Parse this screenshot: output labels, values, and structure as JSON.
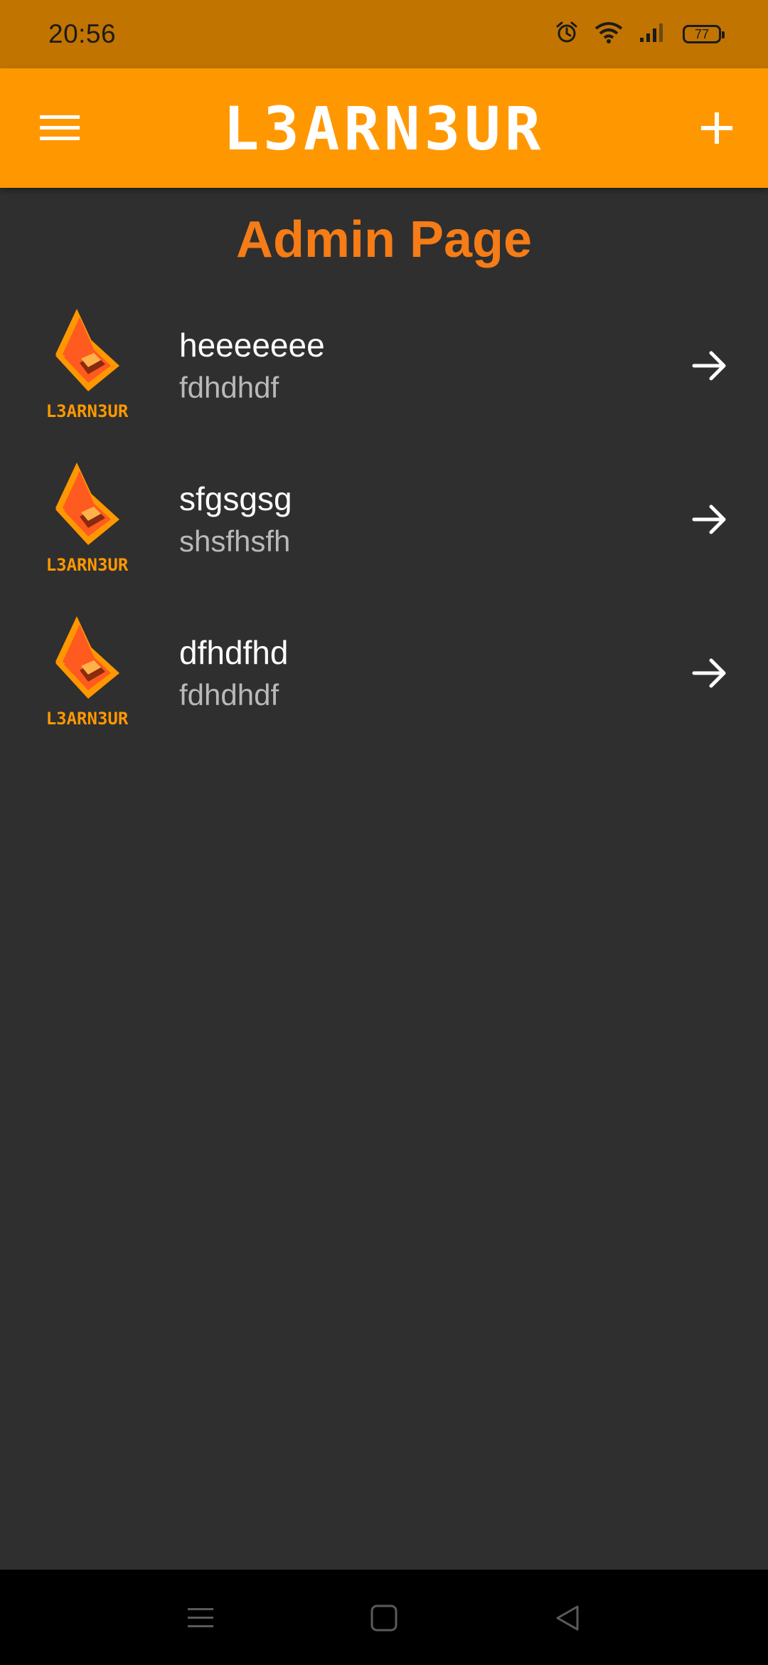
{
  "status_bar": {
    "time": "20:56",
    "battery": "77",
    "icons": [
      "alarm-icon",
      "wifi-icon",
      "signal-icon",
      "battery-icon"
    ]
  },
  "app_bar": {
    "brand": "L3ARN3UR",
    "menu_icon": "hamburger-menu-icon",
    "add_icon": "plus-icon",
    "color": "#ff9800"
  },
  "page": {
    "title": "Admin Page",
    "title_color": "#f57c16",
    "background": "#2f2f2f"
  },
  "list": {
    "items": [
      {
        "title": "heeeeeee",
        "subtitle": "fdhdhdf",
        "logo_text": "L3ARN3UR",
        "icon": "arrow-right-icon"
      },
      {
        "title": "sfgsgsg",
        "subtitle": "shsfhsfh",
        "logo_text": "L3ARN3UR",
        "icon": "arrow-right-icon"
      },
      {
        "title": "dfhdfhd",
        "subtitle": "fdhdhdf",
        "logo_text": "L3ARN3UR",
        "icon": "arrow-right-icon"
      }
    ]
  },
  "nav_bar": {
    "icons": [
      "recent-apps-icon",
      "home-icon",
      "back-icon"
    ]
  }
}
